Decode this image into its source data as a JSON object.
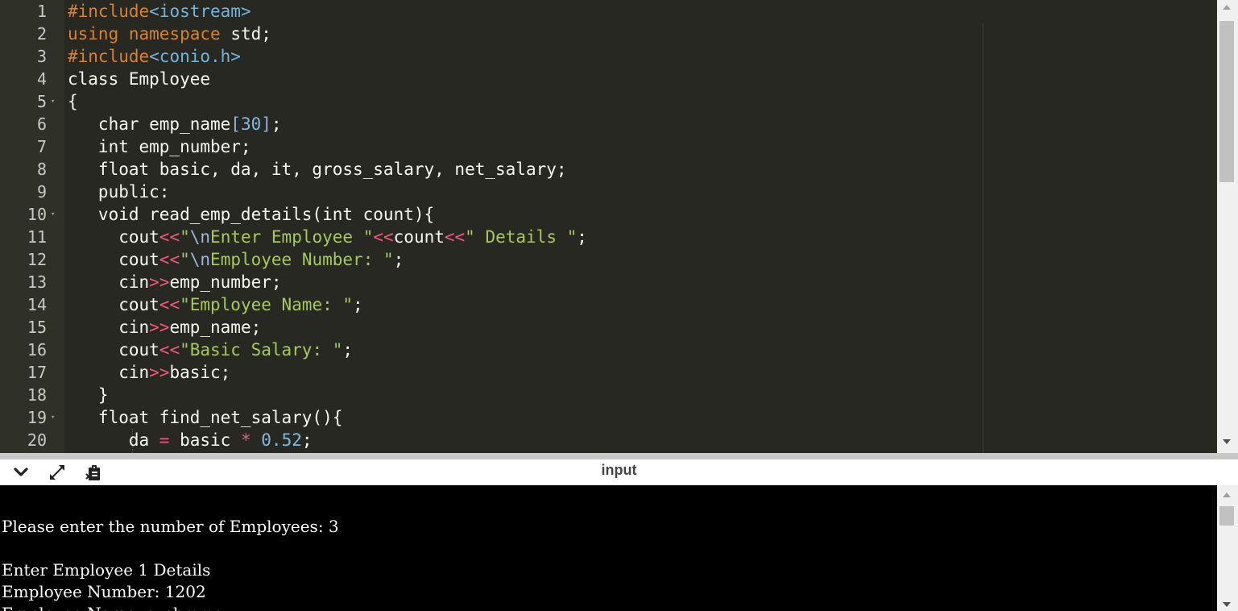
{
  "editor": {
    "line_numbers": [
      "1",
      "2",
      "3",
      "4",
      "5",
      "6",
      "7",
      "8",
      "9",
      "10",
      "11",
      "12",
      "13",
      "14",
      "15",
      "16",
      "17",
      "18",
      "19",
      "20"
    ],
    "fold_lines": [
      "5",
      "10",
      "19"
    ],
    "lines": [
      [
        {
          "t": "#include",
          "c": "pre"
        },
        {
          "t": "<iostream>",
          "c": "hdr"
        }
      ],
      [
        {
          "t": "using",
          "c": "kw"
        },
        {
          "t": " "
        },
        {
          "t": "namespace",
          "c": "kw"
        },
        {
          "t": " std;"
        }
      ],
      [
        {
          "t": "#include",
          "c": "pre"
        },
        {
          "t": "<conio.h>",
          "c": "hdr"
        }
      ],
      [
        {
          "t": "class Employee"
        }
      ],
      [
        {
          "t": "{"
        }
      ],
      [
        {
          "t": "   char emp_name"
        },
        {
          "t": "[",
          "c": "brk"
        },
        {
          "t": "30",
          "c": "num"
        },
        {
          "t": "]",
          "c": "brk"
        },
        {
          "t": ";"
        }
      ],
      [
        {
          "t": "   int emp_number;"
        }
      ],
      [
        {
          "t": "   float basic, da, it, gross_salary, net_salary;"
        }
      ],
      [
        {
          "t": "   public:"
        }
      ],
      [
        {
          "t": "   void read_emp_details(int count){"
        }
      ],
      [
        {
          "t": "     cout"
        },
        {
          "t": "<<",
          "c": "op"
        },
        {
          "t": "\"",
          "c": "str"
        },
        {
          "t": "\\n",
          "c": "esc"
        },
        {
          "t": "Enter Employee ",
          "c": "str"
        },
        {
          "t": "\"",
          "c": "str"
        },
        {
          "t": "<<",
          "c": "op"
        },
        {
          "t": "count"
        },
        {
          "t": "<<",
          "c": "op"
        },
        {
          "t": "\" Details \"",
          "c": "str"
        },
        {
          "t": ";"
        }
      ],
      [
        {
          "t": "     cout"
        },
        {
          "t": "<<",
          "c": "op"
        },
        {
          "t": "\"",
          "c": "str"
        },
        {
          "t": "\\n",
          "c": "esc"
        },
        {
          "t": "Employee Number: ",
          "c": "str"
        },
        {
          "t": "\"",
          "c": "str"
        },
        {
          "t": ";"
        }
      ],
      [
        {
          "t": "     cin"
        },
        {
          "t": ">>",
          "c": "op"
        },
        {
          "t": "emp_number;"
        }
      ],
      [
        {
          "t": "     cout"
        },
        {
          "t": "<<",
          "c": "op"
        },
        {
          "t": "\"Employee Name: \"",
          "c": "str"
        },
        {
          "t": ";"
        }
      ],
      [
        {
          "t": "     cin"
        },
        {
          "t": ">>",
          "c": "op"
        },
        {
          "t": "emp_name;"
        }
      ],
      [
        {
          "t": "     cout"
        },
        {
          "t": "<<",
          "c": "op"
        },
        {
          "t": "\"Basic Salary: \"",
          "c": "str"
        },
        {
          "t": ";"
        }
      ],
      [
        {
          "t": "     cin"
        },
        {
          "t": ">>",
          "c": "op"
        },
        {
          "t": "basic;"
        }
      ],
      [
        {
          "t": "   }"
        }
      ],
      [
        {
          "t": "   float find_net_salary(){"
        }
      ],
      [
        {
          "t": "      da "
        },
        {
          "t": "=",
          "c": "op"
        },
        {
          "t": " basic "
        },
        {
          "t": "*",
          "c": "op"
        },
        {
          "t": " "
        },
        {
          "t": "0.52",
          "c": "num"
        },
        {
          "t": ";"
        }
      ]
    ]
  },
  "toolbar": {
    "title": "input",
    "collapse_icon": "chevron-down-icon",
    "expand_icon": "expand-arrows-icon",
    "clear_icon": "clipboard-icon"
  },
  "console": {
    "lines": [
      "",
      "Please enter the number of Employees: 3",
      "",
      "Enter Employee 1 Details",
      "Employee Number: 1202",
      "Employee Name: sushmma"
    ]
  },
  "colors": {
    "editor_bg": "#272822",
    "gutter_bg": "#2f3129",
    "keyword": "#d9822b",
    "string": "#a6c95a",
    "number": "#82b9e0",
    "operator": "#f5577a",
    "console_bg": "#000000",
    "console_text": "#ffffff"
  }
}
